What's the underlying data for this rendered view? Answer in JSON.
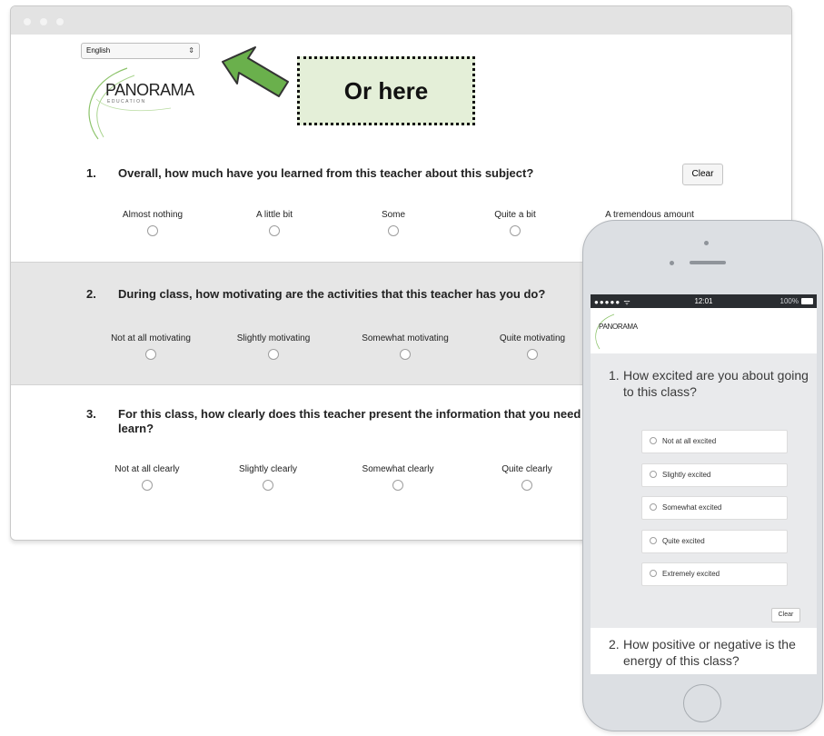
{
  "browser": {
    "language_select": {
      "value": "English"
    }
  },
  "logo": {
    "word": "PANORAMA",
    "sub": "EDUCATION"
  },
  "callout": {
    "text": "Or here",
    "background": "#e4efd8",
    "arrow_color": "#6ab04c"
  },
  "desktop_survey": {
    "clear_label": "Clear",
    "questions": [
      {
        "number": "1.",
        "text": "Overall, how much have you learned from this teacher about this subject?",
        "options": [
          "Almost nothing",
          "A little bit",
          "Some",
          "Quite a bit",
          "A tremendous amount"
        ]
      },
      {
        "number": "2.",
        "text": "During class, how motivating are the activities that this teacher has you do?",
        "options": [
          "Not at all motivating",
          "Slightly motivating",
          "Somewhat motivating",
          "Quite motivating"
        ]
      },
      {
        "number": "3.",
        "text_line1": "For this class, how clearly does this teacher present the information that you need t",
        "text_line2": "learn?",
        "options": [
          "Not at all clearly",
          "Slightly clearly",
          "Somewhat clearly",
          "Quite clearly"
        ]
      }
    ]
  },
  "phone": {
    "status": {
      "signal": "●●●●● ᯤ",
      "time": "12:01",
      "battery": "100%"
    },
    "logo": "PANORAMA",
    "question1": {
      "number": "1.",
      "text": "How excited are you about going to this class?",
      "options": [
        "Not at all excited",
        "Slightly excited",
        "Somewhat excited",
        "Quite excited",
        "Extremely excited"
      ]
    },
    "clear_label": "Clear",
    "question2": {
      "number": "2.",
      "text": "How positive or negative is the energy of this class?"
    }
  }
}
